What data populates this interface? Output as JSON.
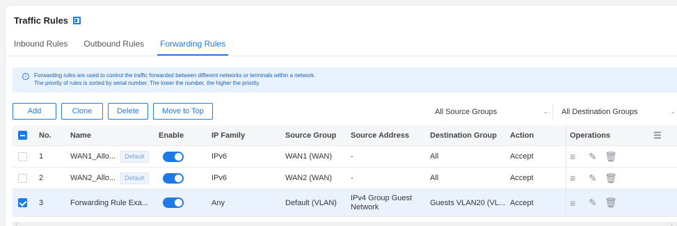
{
  "page": {
    "title": "Traffic Rules"
  },
  "tabs": [
    {
      "label": "Inbound Rules",
      "active": false
    },
    {
      "label": "Outbound Rules",
      "active": false
    },
    {
      "label": "Forwarding Rules",
      "active": true
    }
  ],
  "info": {
    "line1": "Forwarding rules are used to control the traffic forwarded between different networks or terminals within a network.",
    "line2": "The priority of rules is sorted by serial number. The lower the number, the higher the priority."
  },
  "toolbar": {
    "add": "Add",
    "clone": "Clone",
    "delete": "Delete",
    "move_top": "Move to Top"
  },
  "filters": {
    "source": "All Source Groups",
    "destination": "All Destination Groups"
  },
  "table": {
    "columns": [
      "No.",
      "Name",
      "Enable",
      "IP Family",
      "Source Group",
      "Source Address",
      "Destination Group",
      "Action",
      "Operations"
    ],
    "rows": [
      {
        "no": "1",
        "name": "WAN1_Allo...",
        "badge": "Default",
        "enabled": true,
        "ip_family": "IPv6",
        "source_group": "WAN1 (WAN)",
        "source_address": "-",
        "destination_group": "All",
        "action": "Accept",
        "checked": false
      },
      {
        "no": "2",
        "name": "WAN2_Allo...",
        "badge": "Default",
        "enabled": true,
        "ip_family": "IPv6",
        "source_group": "WAN2 (WAN)",
        "source_address": "-",
        "destination_group": "All",
        "action": "Accept",
        "checked": false
      },
      {
        "no": "3",
        "name": "Forwarding Rule Exa...",
        "badge": "",
        "enabled": true,
        "ip_family": "Any",
        "source_group": "Default (VLAN)",
        "source_address": "IPv4 Group Guest Network",
        "destination_group": "Guests VLAN20 (VL...",
        "action": "Accept",
        "checked": true
      }
    ]
  },
  "colors": {
    "accent": "#1e7ae6",
    "info_bg": "#e8f2fd",
    "selected_row": "#eaf3fd"
  },
  "icons": [
    "info-icon",
    "bookmark-icon",
    "chevron-down-icon",
    "adjust-icon",
    "edit-icon",
    "trash-icon",
    "menu-icon"
  ]
}
